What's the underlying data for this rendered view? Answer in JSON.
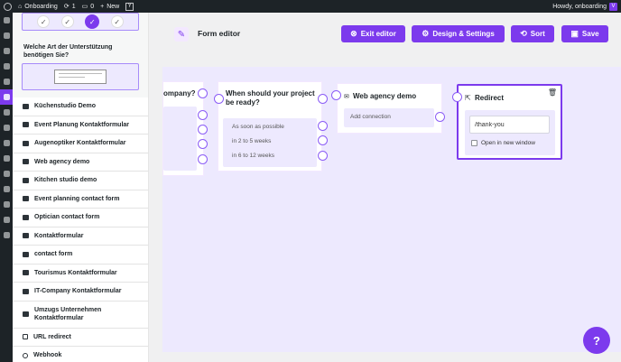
{
  "admin_bar": {
    "site_name": "Onboarding",
    "updates": "1",
    "comments": "0",
    "new_label": "New",
    "howdy": "Howdy, onboarding"
  },
  "sidebar": {
    "question_title": "Welche Art der Unterstützung benötigen Sie?",
    "items": [
      {
        "label": "Küchenstudio Demo",
        "icon": "envelope-icon"
      },
      {
        "label": "Event Planung Kontaktformular",
        "icon": "envelope-icon"
      },
      {
        "label": "Augenoptiker Kontaktformular",
        "icon": "envelope-icon"
      },
      {
        "label": "Web agency demo",
        "icon": "envelope-icon"
      },
      {
        "label": "Kitchen studio demo",
        "icon": "envelope-icon"
      },
      {
        "label": "Event planning contact form",
        "icon": "envelope-icon"
      },
      {
        "label": "Optician contact form",
        "icon": "envelope-icon"
      },
      {
        "label": "Kontaktformular",
        "icon": "envelope-icon"
      },
      {
        "label": "contact form",
        "icon": "envelope-icon"
      },
      {
        "label": "Tourismus Kontaktformular",
        "icon": "envelope-icon"
      },
      {
        "label": "IT-Company Kontaktformular",
        "icon": "envelope-icon"
      },
      {
        "label": "Umzugs Unternehmen Kontaktformular",
        "icon": "envelope-icon"
      },
      {
        "label": "URL redirect",
        "icon": "external-link-icon"
      },
      {
        "label": "Webhook",
        "icon": "webhook-icon"
      }
    ]
  },
  "header": {
    "title": "Form editor",
    "exit_label": "Exit editor",
    "design_label": "Design & Settings",
    "sort_label": "Sort",
    "save_label": "Save"
  },
  "canvas": {
    "company_node_title": "ompany?",
    "project_node": {
      "title": "When should your project be ready?",
      "options": [
        "As soon as possible",
        "in 2 to 5 weeks",
        "in 6 to 12 weeks"
      ]
    },
    "agency_node": {
      "title": "Web agency demo",
      "add_connection": "Add connection"
    },
    "redirect_node": {
      "title": "Redirect",
      "url_value": "/thank-you",
      "new_window_label": "Open in new window"
    }
  },
  "help_label": "?",
  "colors": {
    "accent": "#7c3aed",
    "canvas": "#ede9fe",
    "wp_dark": "#1d2327"
  }
}
